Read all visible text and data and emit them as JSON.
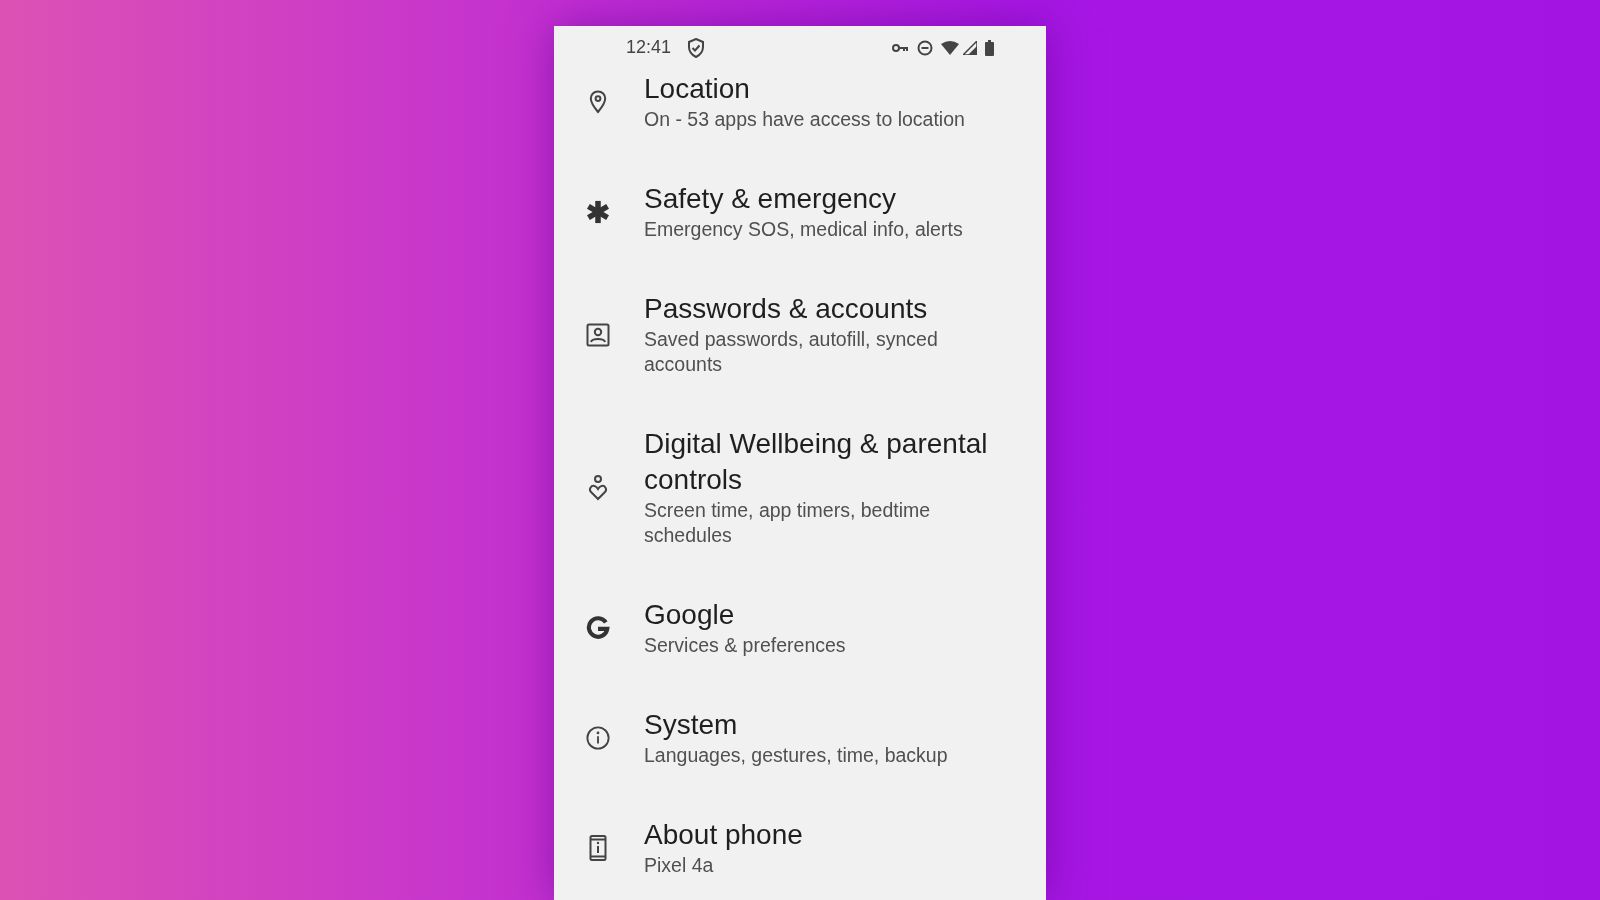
{
  "status_bar": {
    "time": "12:41"
  },
  "settings": [
    {
      "title": "Location",
      "subtitle": "On - 53 apps have access to location"
    },
    {
      "title": "Safety & emergency",
      "subtitle": "Emergency SOS, medical info, alerts"
    },
    {
      "title": "Passwords & accounts",
      "subtitle": "Saved passwords, autofill, synced accounts"
    },
    {
      "title": "Digital Wellbeing & parental controls",
      "subtitle": "Screen time, app timers, bedtime schedules"
    },
    {
      "title": "Google",
      "subtitle": "Services & preferences"
    },
    {
      "title": "System",
      "subtitle": "Languages, gestures, time, backup"
    },
    {
      "title": "About phone",
      "subtitle": "Pixel 4a"
    }
  ]
}
